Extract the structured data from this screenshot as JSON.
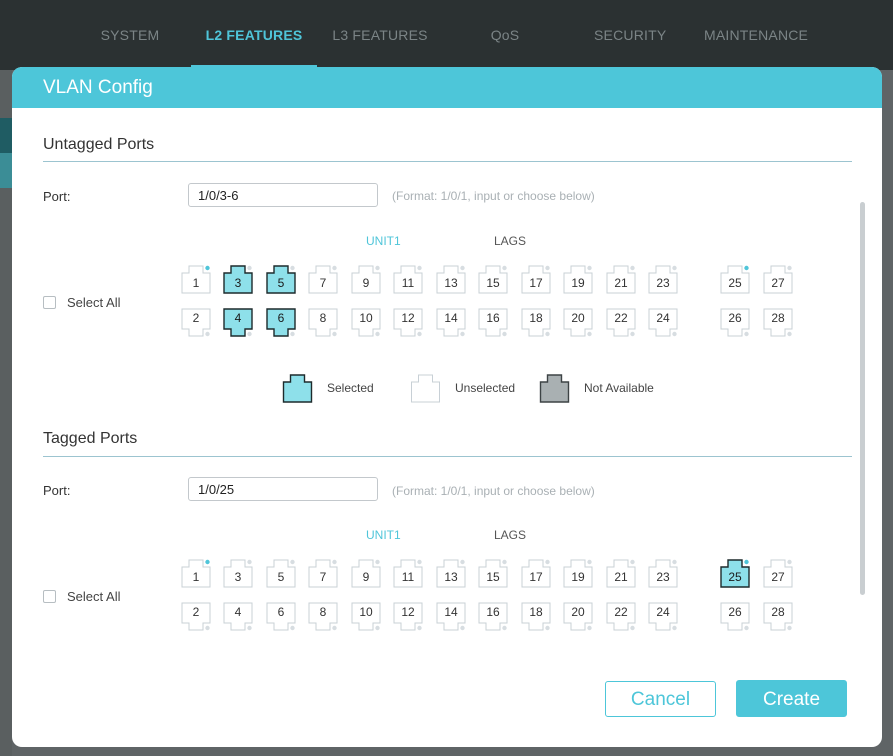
{
  "nav": {
    "tabs": [
      {
        "label": "SYSTEM",
        "active": false
      },
      {
        "label": "L2 FEATURES",
        "active": true
      },
      {
        "label": "L3 FEATURES",
        "active": false
      },
      {
        "label": "QoS",
        "active": false
      },
      {
        "label": "SECURITY",
        "active": false
      },
      {
        "label": "MAINTENANCE",
        "active": false
      }
    ]
  },
  "modal": {
    "title": "VLAN Config",
    "untagged": {
      "title": "Untagged Ports",
      "port_label": "Port:",
      "port_value": "1/0/3-6",
      "hint": "(Format: 1/0/1, input or choose below)",
      "unit_label": "UNIT1",
      "lags_label": "LAGS",
      "select_all": "Select All",
      "selected_ports": [
        "3",
        "4",
        "5",
        "6"
      ]
    },
    "legend": {
      "selected": "Selected",
      "unselected": "Unselected",
      "not_available": "Not Available"
    },
    "tagged": {
      "title": "Tagged Ports",
      "port_label": "Port:",
      "port_value": "1/0/25",
      "hint": "(Format: 1/0/1, input or choose below)",
      "unit_label": "UNIT1",
      "lags_label": "LAGS",
      "select_all": "Select All",
      "selected_ports": [
        "25"
      ]
    },
    "ports_top": [
      "1",
      "3",
      "5",
      "7",
      "9",
      "11",
      "13",
      "15",
      "17",
      "19",
      "21",
      "23",
      "25",
      "27"
    ],
    "ports_bottom": [
      "2",
      "4",
      "6",
      "8",
      "10",
      "12",
      "14",
      "16",
      "18",
      "20",
      "22",
      "24",
      "26",
      "28"
    ],
    "link_up_ports": [
      "1",
      "25"
    ],
    "buttons": {
      "cancel": "Cancel",
      "create": "Create"
    },
    "colors": {
      "accent": "#4dc6d9",
      "selected_fill": "#8ee0ea",
      "not_available_fill": "#a9b0b2"
    }
  }
}
